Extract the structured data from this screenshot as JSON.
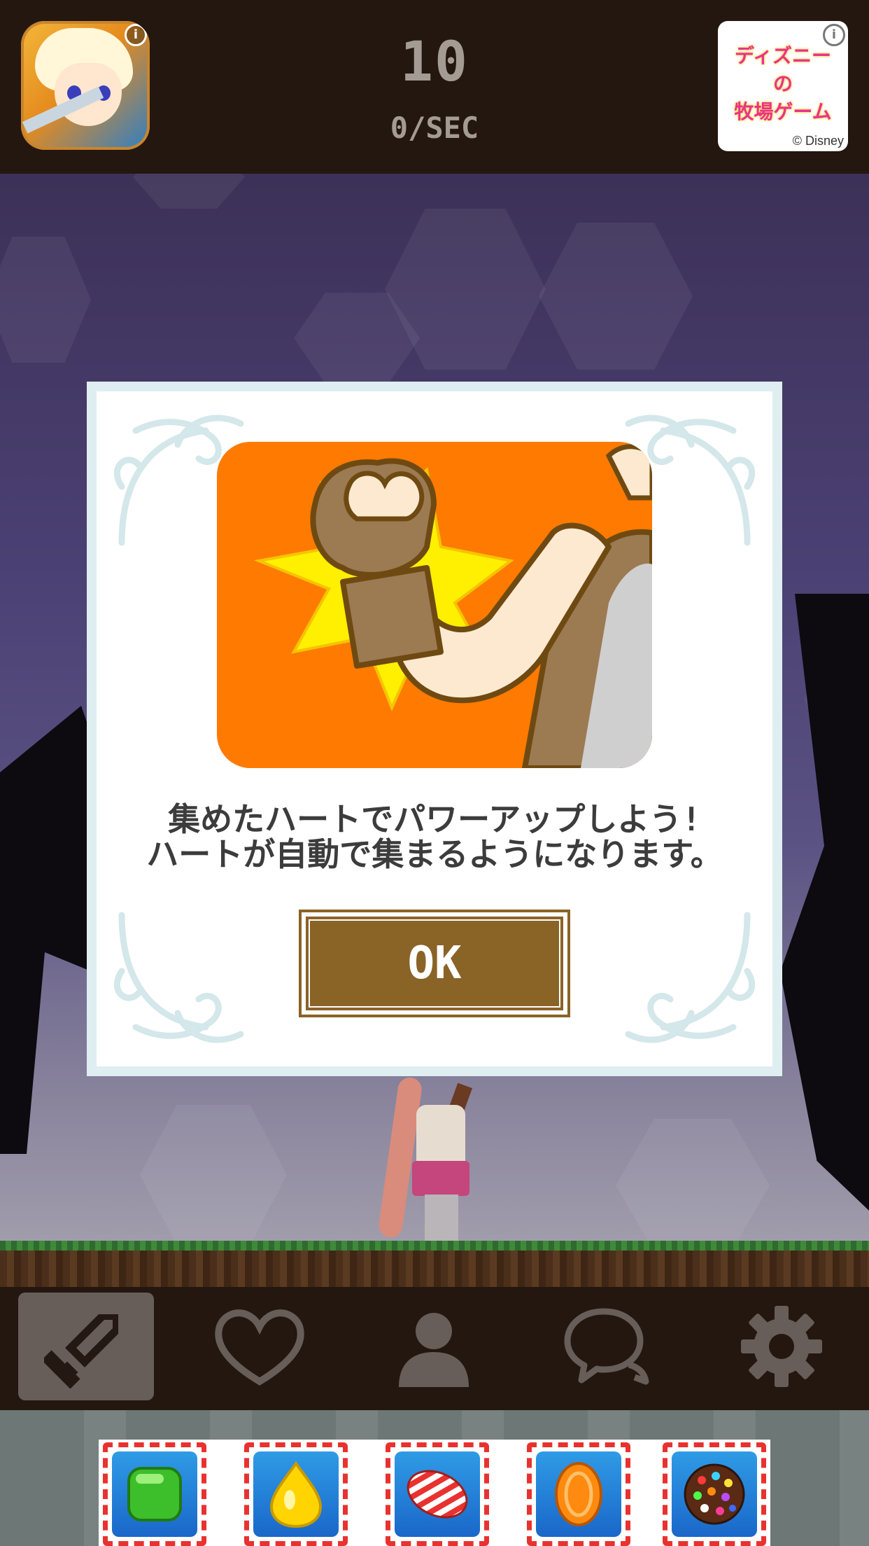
{
  "header": {
    "score_value": "10",
    "score_rate": "0/SEC",
    "info_glyph": "i",
    "ad": {
      "text": "ディズニー\nの\n牧場ゲーム",
      "credit": "© Disney"
    }
  },
  "modal": {
    "message_line1": "集めたハートでパワーアップしよう!",
    "message_line2": "ハートが自動で集まるようになります。",
    "ok_label": "OK",
    "illustration": "flexing-arm-icon"
  },
  "nav": {
    "items": [
      {
        "icon": "sword-icon",
        "active": true
      },
      {
        "icon": "heart-icon",
        "active": false
      },
      {
        "icon": "person-icon",
        "active": false
      },
      {
        "icon": "chat-icon",
        "active": false
      },
      {
        "icon": "gear-icon",
        "active": false
      }
    ]
  },
  "bottom_ad": {
    "candies": [
      "green-candy-icon",
      "yellow-drop-candy-icon",
      "striped-candy-icon",
      "orange-candy-icon",
      "color-bomb-candy-icon"
    ]
  },
  "colors": {
    "header_bg": "#24170f",
    "scene_sky": "#4b4073",
    "modal_frame": "#dfeef1",
    "button_brown": "#8a6327",
    "illustration_orange": "#ff7a00",
    "nav_active": "#675e59"
  }
}
